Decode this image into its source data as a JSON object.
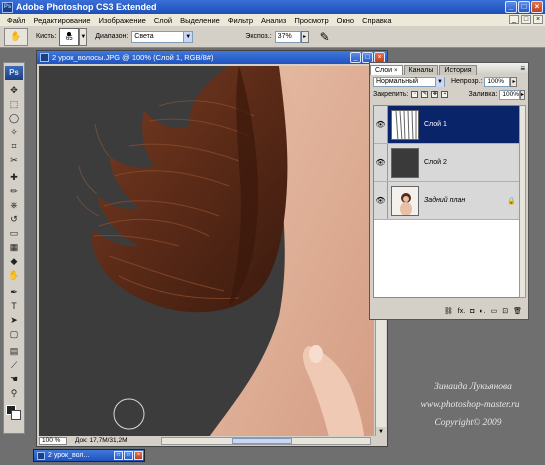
{
  "app": {
    "title": "Adobe Photoshop CS3 Extended",
    "logo": "Ps",
    "window_buttons": [
      "_",
      "□",
      "×"
    ]
  },
  "menu": [
    "Файл",
    "Редактирование",
    "Изображение",
    "Слой",
    "Выделение",
    "Фильтр",
    "Анализ",
    "Просмотр",
    "Окно",
    "Справка"
  ],
  "menu_window_buttons": [
    "_",
    "□",
    "×"
  ],
  "options": {
    "tool_icon": "burn-tool-icon",
    "brush_label": "Кисть:",
    "brush_size": "65",
    "range_label": "Диапазон:",
    "range_value": "Света",
    "exposure_label": "Экспоз.:",
    "exposure_value": "37%",
    "airbrush_icon": "airbrush-icon"
  },
  "document": {
    "title": "2 урок_волосы.JPG @ 100% (Слой 1, RGB/8#)",
    "zoom": "100 %",
    "doc_size": "Док: 17,7M/31,2M",
    "window_buttons": [
      "_",
      "□",
      "×"
    ]
  },
  "layers_panel": {
    "tabs": [
      {
        "label": "Слои",
        "close": "×"
      },
      {
        "label": "Каналы"
      },
      {
        "label": "История"
      }
    ],
    "menu_icon": "≡",
    "blend_mode": "Нормальный",
    "opacity_label": "Непрозр.:",
    "opacity_value": "100%",
    "lock_label": "Закрепить:",
    "fill_label": "Заливка:",
    "fill_value": "100%",
    "layers": [
      {
        "name": "Слой 1",
        "selected": true,
        "thumb": "hair"
      },
      {
        "name": "Слой 2",
        "selected": false,
        "thumb": "dark"
      },
      {
        "name": "Задний план",
        "selected": false,
        "thumb": "photo",
        "italic": true,
        "locked": true
      }
    ],
    "bottom_icons": [
      "⛓",
      "fx.",
      "◘",
      "◐.",
      "▭",
      "⊡",
      "🗑"
    ]
  },
  "watermark": {
    "author": "Зинаида Лукьянова",
    "site": "www.photoshop-master.ru",
    "copyright": "Copyright© 2009"
  },
  "taskbar": {
    "label": "2 урок_вол..."
  },
  "colors": {
    "foreground": "#222222",
    "background": "#ffffff",
    "selection": "#0a246a",
    "title_blue": "#1f52c0"
  }
}
